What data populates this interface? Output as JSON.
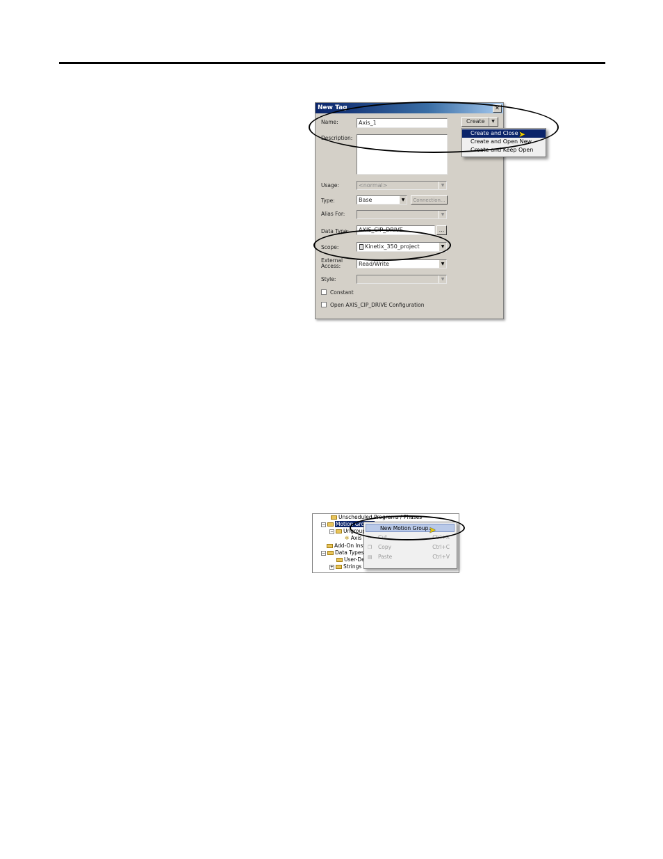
{
  "dialog": {
    "title": "New Tag",
    "close_glyph": "✕",
    "labels": {
      "name": "Name:",
      "description": "Description:",
      "usage": "Usage:",
      "type": "Type:",
      "alias_for": "Alias For:",
      "data_type": "Data Type:",
      "scope": "Scope:",
      "external_access_1": "External",
      "external_access_2": "Access:",
      "style": "Style:"
    },
    "values": {
      "name": "Axis_1",
      "description": "",
      "usage": "<normal>",
      "type": "Base",
      "alias_for": "",
      "data_type": "AXIS_CIP_DRIVE",
      "scope": "Kinetix_350_project",
      "external_access": "Read/Write",
      "style": ""
    },
    "buttons": {
      "create": "Create",
      "connection": "Connection...",
      "browse": "..."
    },
    "checkboxes": {
      "constant": "Constant",
      "open_config": "Open AXIS_CIP_DRIVE Configuration"
    },
    "create_menu": [
      "Create and Close",
      "Create and Open New",
      "Create and Keep Open"
    ]
  },
  "tree": {
    "rows": [
      "Unscheduled Programs / Phases",
      "Motion Groups",
      "Ungrouped Axes",
      "Axis",
      "Add-On Instructions",
      "Data Types",
      "User-Defined",
      "Strings"
    ],
    "context_menu": [
      {
        "label": "New Motion Group...",
        "shortcut": ""
      },
      {
        "label": "Cut",
        "shortcut": "Ctrl+X"
      },
      {
        "label": "Copy",
        "shortcut": "Ctrl+C"
      },
      {
        "label": "Paste",
        "shortcut": "Ctrl+V"
      }
    ]
  }
}
